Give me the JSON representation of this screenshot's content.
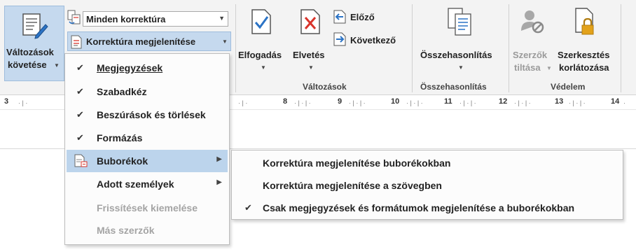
{
  "ribbon": {
    "track_changes": {
      "line1": "Változások",
      "line2": "követése"
    },
    "markup_combo": {
      "value": "Minden korrektúra"
    },
    "show_markup": {
      "label": "Korrektúra megjelenítése"
    },
    "accept": {
      "label": "Elfogadás"
    },
    "reject": {
      "label": "Elvetés"
    },
    "previous": {
      "label": "Előző"
    },
    "next": {
      "label": "Következő"
    },
    "compare": {
      "label": "Összehasonlítás"
    },
    "block_authors": {
      "line1": "Szerzők",
      "line2": "tiltása"
    },
    "restrict_editing": {
      "line1": "Szerkesztés",
      "line2": "korlátozása"
    },
    "groups": {
      "changes": "Változások",
      "compare": "Összehasonlítás",
      "protect": "Védelem"
    }
  },
  "ruler": {
    "numbers": [
      "3",
      "8",
      "9",
      "10",
      "11",
      "12",
      "13",
      "14"
    ]
  },
  "menu": {
    "items": [
      {
        "label": "Megjegyzések",
        "checked": true,
        "submenu": false,
        "enabled": true
      },
      {
        "label": "Szabadkéz",
        "checked": true,
        "submenu": false,
        "enabled": true
      },
      {
        "label": "Beszúrások és törlések",
        "checked": true,
        "submenu": false,
        "enabled": true
      },
      {
        "label": "Formázás",
        "checked": true,
        "submenu": false,
        "enabled": true
      },
      {
        "label": "Buborékok",
        "checked": false,
        "submenu": true,
        "enabled": true
      },
      {
        "label": "Adott személyek",
        "checked": false,
        "submenu": true,
        "enabled": true
      },
      {
        "label": "Frissítések kiemelése",
        "checked": false,
        "submenu": false,
        "enabled": false
      },
      {
        "label": "Más szerzők",
        "checked": false,
        "submenu": false,
        "enabled": false
      }
    ]
  },
  "submenu": {
    "items": [
      {
        "label": "Korrektúra megjelenítése buborékokban",
        "checked": false
      },
      {
        "label": "Korrektúra megjelenítése a szövegben",
        "checked": false
      },
      {
        "label": "Csak megjegyzések és formátumok megjelenítése a buborékokban",
        "checked": true
      }
    ]
  },
  "colors": {
    "highlight": "#bcd4ec",
    "accent_blue": "#2b73c5",
    "reject_red": "#d9342b",
    "lock_gold": "#e3a21a"
  }
}
